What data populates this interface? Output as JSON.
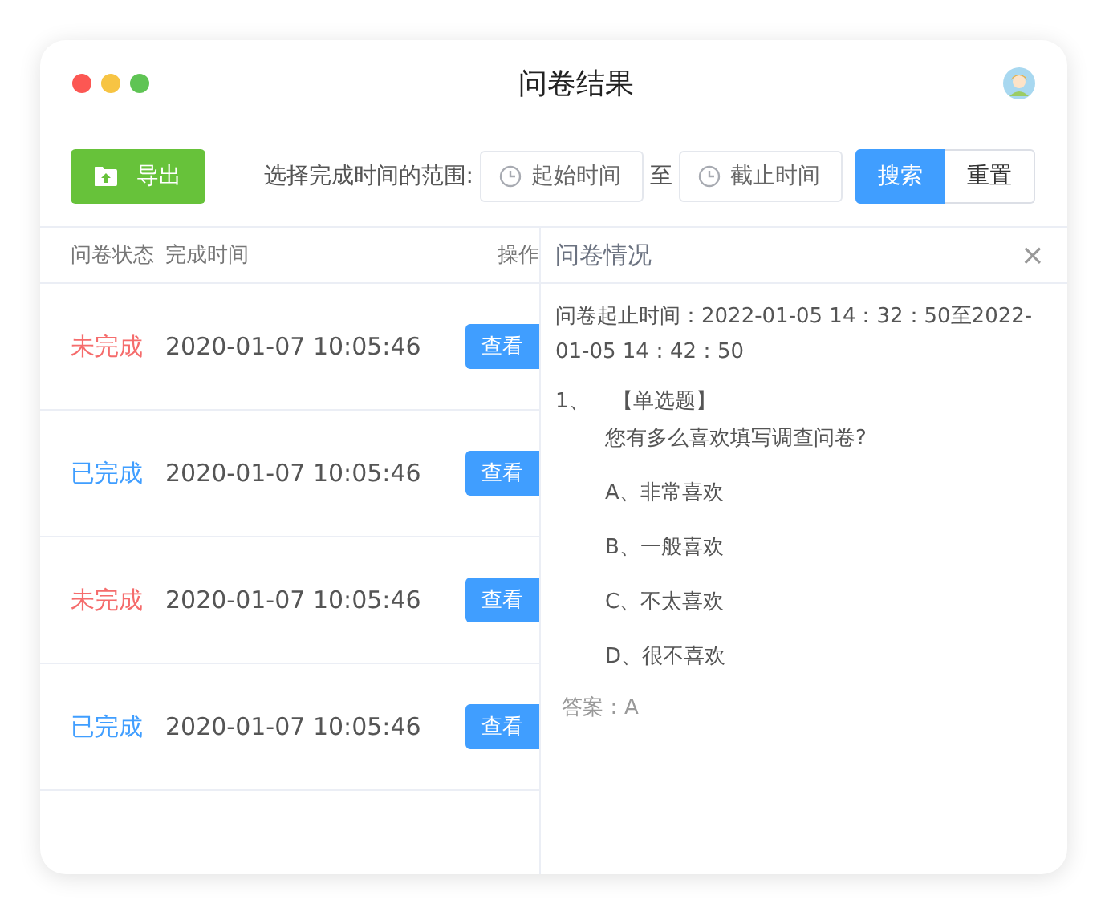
{
  "window": {
    "title": "问卷结果"
  },
  "toolbar": {
    "export_button": "导出",
    "range_label": "选择完成时间的范围:",
    "start_placeholder": "起始时间",
    "separator": "至",
    "end_placeholder": "截止时间",
    "search_button": "搜索",
    "reset_button": "重置"
  },
  "table": {
    "columns": [
      "问卷状态",
      "完成时间",
      "操作"
    ],
    "rows": [
      {
        "status": "未完成",
        "done": false,
        "time": "2020-01-07 10:05:46",
        "action": "查看"
      },
      {
        "status": "已完成",
        "done": true,
        "time": "2020-01-07 10:05:46",
        "action": "查看"
      },
      {
        "status": "未完成",
        "done": false,
        "time": "2020-01-07 10:05:46",
        "action": "查看"
      },
      {
        "status": "已完成",
        "done": true,
        "time": "2020-01-07 10:05:46",
        "action": "查看"
      }
    ]
  },
  "detail": {
    "title": "问卷情况",
    "close": "×",
    "period": "问卷起止时间：2022-01-05 14：32：50至2022-01-05 14：42：50",
    "question": {
      "number": "1、",
      "type": "【单选题】",
      "text": "您有多么喜欢填写调查问卷?",
      "options": [
        "A、非常喜欢",
        "B、一般喜欢",
        "C、不太喜欢",
        "D、很不喜欢"
      ],
      "answer": "答案：A"
    }
  }
}
